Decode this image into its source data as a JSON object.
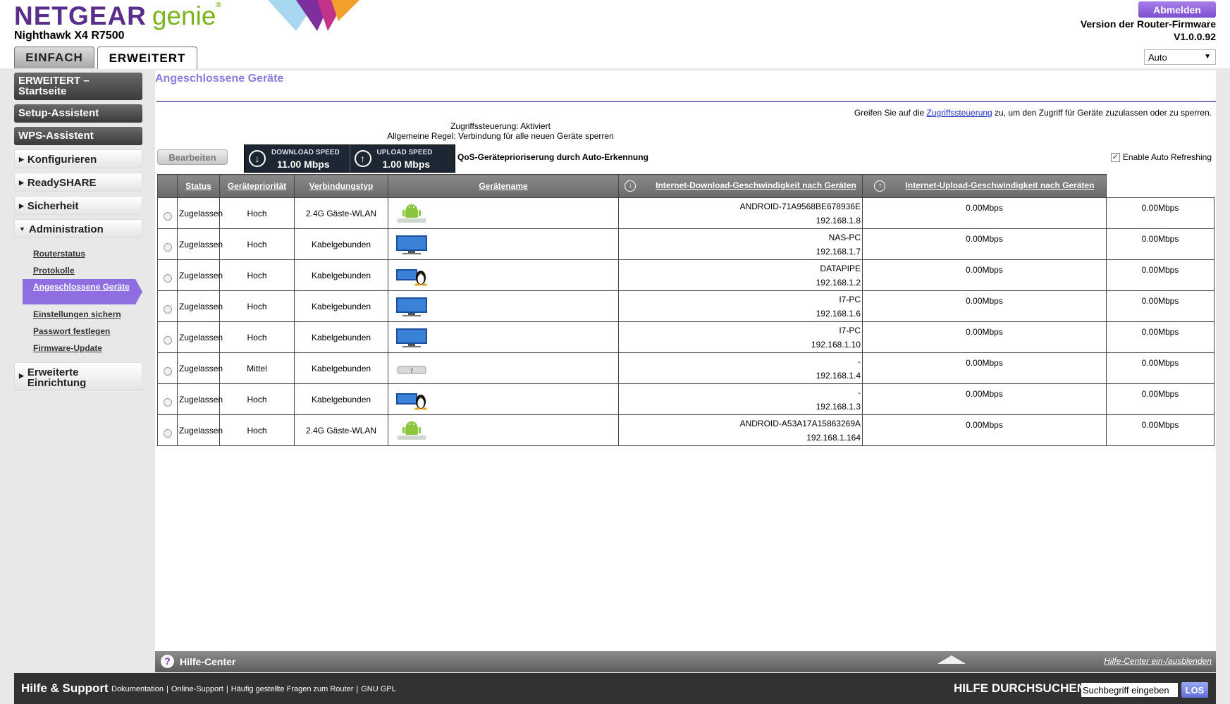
{
  "header": {
    "brand": "NETGEAR",
    "brand_genie": "genie",
    "brand_mark": "®",
    "model": "Nighthawk X4 R7500",
    "tabs": [
      "EINFACH",
      "ERWEITERT"
    ],
    "logout_label": "Abmelden",
    "firmware_label": "Version der Router-Firmware",
    "firmware_version": "V1.0.0.92",
    "language_selected": "Auto",
    "colors": {
      "brand": "#5a2e8c",
      "genie": "#7ab51d",
      "accent": "#8e6ee0"
    }
  },
  "sidebar": {
    "dark_items": [
      "ERWEITERT –\nStartseite",
      "Setup-Assistent",
      "WPS-Assistent"
    ],
    "sections": [
      "Konfigurieren",
      "ReadySHARE",
      "Sicherheit",
      "Administration",
      "Erweiterte\nEinrichtung"
    ],
    "admin_items": [
      "Routerstatus",
      "Protokolle",
      "Angeschlossene Geräte",
      "Einstellungen sichern",
      "Passwort festlegen",
      "Firmware-Update"
    ]
  },
  "main": {
    "title": "Angeschlossene Geräte",
    "access_note_pre": "Greifen Sie auf die ",
    "access_note_link": "Zugriffssteuerung",
    "access_note_post": " zu, um den Zugriff für Geräte zuzulassen oder zu sperren.",
    "access_status": "Zugriffssteuerung: Aktiviert",
    "general_rule": "Allgemeine Regel: Verbindung für alle neuen Geräte sperren",
    "edit_label": "Bearbeiten",
    "download_label": "DOWNLOAD SPEED",
    "download_value": "11.00 Mbps",
    "upload_label": "UPLOAD SPEED",
    "upload_value": "1.00 Mbps",
    "qos_label": "QoS-Geräteprioriserung durch Auto-Erkennung",
    "auto_refresh_label": "Enable Auto Refreshing",
    "auto_refresh_checked": true
  },
  "table": {
    "headers": [
      "Status",
      "Gerätepriorität",
      "Verbindungstyp",
      "Gerätename",
      "Internet-Download-Geschwindigkeit nach Geräten",
      "Internet-Upload-Geschwindigkeit nach Geräten"
    ],
    "rows": [
      {
        "status": "Zugelassen",
        "priority": "Hoch",
        "conn": "2.4G Gäste-WLAN",
        "icon": "android-icon",
        "name": "ANDROID-71A9568BE678936E",
        "ip": "192.168.1.8",
        "down": "0.00Mbps",
        "up": "0.00Mbps"
      },
      {
        "status": "Zugelassen",
        "priority": "Hoch",
        "conn": "Kabelgebunden",
        "icon": "monitor-icon",
        "name": "NAS-PC",
        "ip": "192.168.1.7",
        "down": "0.00Mbps",
        "up": "0.00Mbps"
      },
      {
        "status": "Zugelassen",
        "priority": "Hoch",
        "conn": "Kabelgebunden",
        "icon": "linux-icon",
        "name": "DATAPIPE",
        "ip": "192.168.1.2",
        "down": "0.00Mbps",
        "up": "0.00Mbps"
      },
      {
        "status": "Zugelassen",
        "priority": "Hoch",
        "conn": "Kabelgebunden",
        "icon": "monitor-icon",
        "name": "I7-PC",
        "ip": "192.168.1.6",
        "down": "0.00Mbps",
        "up": "0.00Mbps"
      },
      {
        "status": "Zugelassen",
        "priority": "Hoch",
        "conn": "Kabelgebunden",
        "icon": "monitor-icon",
        "name": "I7-PC",
        "ip": "192.168.1.10",
        "down": "0.00Mbps",
        "up": "0.00Mbps"
      },
      {
        "status": "Zugelassen",
        "priority": "Mittel",
        "conn": "Kabelgebunden",
        "icon": "unknown-device-icon",
        "name": "-",
        "ip": "192.168.1.4",
        "down": "0.00Mbps",
        "up": "0.00Mbps"
      },
      {
        "status": "Zugelassen",
        "priority": "Hoch",
        "conn": "Kabelgebunden",
        "icon": "linux-icon",
        "name": "-",
        "ip": "192.168.1.3",
        "down": "0.00Mbps",
        "up": "0.00Mbps"
      },
      {
        "status": "Zugelassen",
        "priority": "Hoch",
        "conn": "2.4G Gäste-WLAN",
        "icon": "android-icon",
        "name": "ANDROID-A53A17A15863269A",
        "ip": "192.168.1.164",
        "down": "0.00Mbps",
        "up": "0.00Mbps"
      }
    ]
  },
  "help_center": {
    "title": "Hilfe-Center",
    "toggle": "Hilfe-Center ein-/ausblenden"
  },
  "footer": {
    "title": "Hilfe & Support",
    "links": [
      "Dokumentation",
      "Online-Support",
      "Häufig gestellte Fragen zum Router",
      "GNU GPL"
    ],
    "search_label": "HILFE DURCHSUCHEN",
    "search_value": "Suchbegriff eingeben",
    "search_button": "LOS"
  }
}
